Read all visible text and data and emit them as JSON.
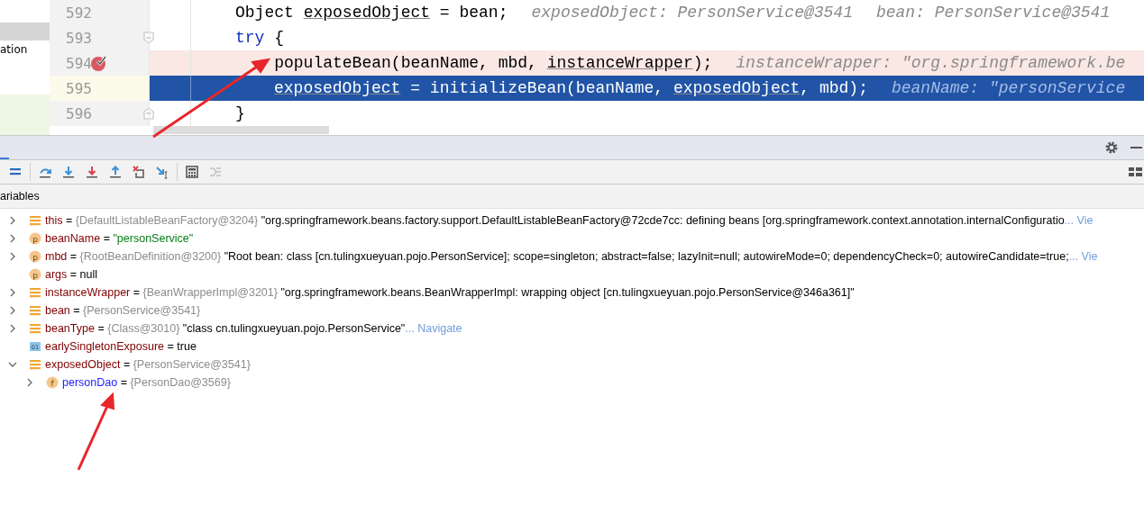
{
  "project_tree": {
    "items": [
      {
        "selected": true
      },
      {
        "label": "ation",
        "selected": false
      }
    ]
  },
  "editor": {
    "lines": [
      {
        "number": "592",
        "kind": "normal",
        "fold": false,
        "tokens": [
          {
            "text": "Object ",
            "kind": "plain"
          },
          {
            "text": "exposedObject",
            "kind": "ref"
          },
          {
            "text": " = bean;",
            "kind": "plain"
          }
        ],
        "hints": [
          "exposedObject: PersonService@3541",
          "bean: PersonService@3541"
        ]
      },
      {
        "number": "593",
        "kind": "normal",
        "fold": true,
        "tokens": [
          {
            "text": "try",
            "kind": "keyword"
          },
          {
            "text": " {",
            "kind": "plain"
          }
        ]
      },
      {
        "number": "594",
        "kind": "breakpoint",
        "fold": false,
        "tokens": [
          {
            "text": "    populateBean(beanName, mbd, ",
            "kind": "plain"
          },
          {
            "text": "instanceWrapper",
            "kind": "ref"
          },
          {
            "text": ");",
            "kind": "plain"
          }
        ],
        "hints": [
          "instanceWrapper: \"org.springframework.be"
        ]
      },
      {
        "number": "595",
        "kind": "execution",
        "fold": false,
        "tokens": [
          {
            "text": "exposedObject",
            "kind": "ref"
          },
          {
            "text": " = initializeBean(beanName, ",
            "kind": "plain"
          },
          {
            "text": "exposedObject",
            "kind": "ref"
          },
          {
            "text": ", mbd);",
            "kind": "plain"
          }
        ],
        "hints": [
          "beanName: \"personService"
        ]
      },
      {
        "number": "596",
        "kind": "normal",
        "fold": true,
        "tokens": [
          {
            "text": "}",
            "kind": "plain"
          }
        ]
      }
    ]
  },
  "debug_toolbar": [
    {
      "kind": "frames"
    },
    {
      "kind": "separator"
    },
    {
      "kind": "step-over"
    },
    {
      "kind": "step-into"
    },
    {
      "kind": "force-step-into"
    },
    {
      "kind": "step-out"
    },
    {
      "kind": "drop-frame"
    },
    {
      "kind": "run-to-cursor"
    },
    {
      "kind": "separator"
    },
    {
      "kind": "evaluate"
    },
    {
      "kind": "trace",
      "disabled": true
    }
  ],
  "variables_label": "ariables",
  "variables": [
    {
      "kind": "object",
      "expandable": true,
      "expanded": false,
      "name": "this",
      "op": "=",
      "type": "{DefaultListableBeanFactory@3204}",
      "value": "\"org.springframework.beans.factory.support.DefaultListableBeanFactory@72cde7cc: defining beans [org.springframework.context.annotation.internalConfiguratio",
      "is_string": false,
      "link": "... Vie"
    },
    {
      "kind": "param",
      "badge": "p",
      "expandable": true,
      "expanded": false,
      "name": "beanName",
      "op": "=",
      "value": "\"personService\"",
      "is_string": true
    },
    {
      "kind": "param",
      "badge": "p",
      "expandable": true,
      "expanded": false,
      "name": "mbd",
      "op": "=",
      "type": "{RootBeanDefinition@3200}",
      "value": "\"Root bean: class [cn.tulingxueyuan.pojo.PersonService]; scope=singleton; abstract=false; lazyInit=null; autowireMode=0; dependencyCheck=0; autowireCandidate=true;",
      "is_string": false,
      "link": "... Vie"
    },
    {
      "kind": "param",
      "badge": "p",
      "expandable": false,
      "name": "args",
      "op": "=",
      "value": "null",
      "is_string": false
    },
    {
      "kind": "object",
      "expandable": true,
      "expanded": false,
      "name": "instanceWrapper",
      "op": "=",
      "type": "{BeanWrapperImpl@3201}",
      "value": "\"org.springframework.beans.BeanWrapperImpl: wrapping object [cn.tulingxueyuan.pojo.PersonService@346a361]\"",
      "is_string": false
    },
    {
      "kind": "object",
      "expandable": true,
      "expanded": false,
      "name": "bean",
      "op": "=",
      "type": "{PersonService@3541}"
    },
    {
      "kind": "object",
      "expandable": true,
      "expanded": false,
      "name": "beanType",
      "op": "=",
      "type": "{Class@3010}",
      "value": "\"class cn.tulingxueyuan.pojo.PersonService\"",
      "is_string": false,
      "link": "... Navigate"
    },
    {
      "kind": "boolean",
      "badge": "01",
      "expandable": false,
      "name": "earlySingletonExposure",
      "op": "=",
      "value": "true",
      "is_string": false
    },
    {
      "kind": "object",
      "expandable": true,
      "expanded": true,
      "name": "exposedObject",
      "op": "=",
      "type": "{PersonService@3541}",
      "children": [
        {
          "kind": "field",
          "badge": "f",
          "expandable": true,
          "expanded": false,
          "name": "personDao",
          "op": "=",
          "type": "{PersonDao@3569}"
        }
      ]
    }
  ]
}
